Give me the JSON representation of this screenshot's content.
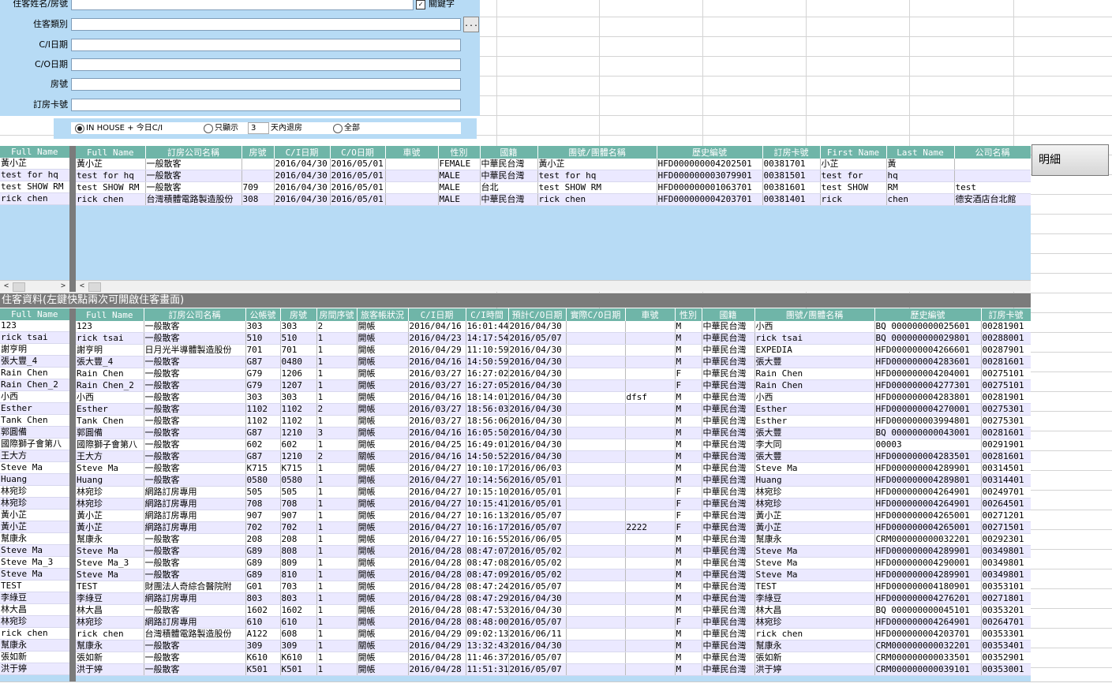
{
  "form": {
    "labels": [
      "住客姓名/房號",
      "住客類別",
      "C/I日期",
      "C/O日期",
      "房號",
      "訂房卡號"
    ],
    "keyword_label": "關鍵字",
    "keyword_checked": true,
    "dots_label": "..."
  },
  "filter": {
    "opt1": "IN HOUSE + 今日C/I",
    "opt2_prefix": "只顯示",
    "opt2_days": "3",
    "opt2_suffix": "天內退房",
    "opt3": "全部",
    "selected": "opt1"
  },
  "detail_button": "明細",
  "top_grid": {
    "fixed_header": "Full Name",
    "fixed_rows": [
      "黃小芷",
      "test for hq",
      "test SHOW RM",
      "rick chen"
    ],
    "columns": [
      "Full Name",
      "訂房公司名稱",
      "房號",
      "C/I日期",
      "C/O日期",
      "車號",
      "性別",
      "國籍",
      "團號/團體名稱",
      "歷史編號",
      "訂房卡號",
      "First Name",
      "Last Name",
      "公司名稱"
    ],
    "rows": [
      [
        "黃小芷",
        "一般散客",
        "",
        "2016/04/30",
        "2016/05/01",
        "",
        "FEMALE",
        "中華民台灣",
        "黃小芷",
        "HFD000000004202501",
        "00381701",
        "小芷",
        "黃",
        ""
      ],
      [
        "test for hq",
        "一般散客",
        "",
        "2016/04/30",
        "2016/05/01",
        "",
        "MALE",
        "中華民台灣",
        "test for hq",
        "HFD000000003079901",
        "00381501",
        "test for",
        "hq",
        ""
      ],
      [
        "test SHOW RM",
        "一般散客",
        "709",
        "2016/04/30",
        "2016/05/01",
        "",
        "MALE",
        "台北",
        "test SHOW RM",
        "HFD000000001063701",
        "00381601",
        "test SHOW",
        "RM",
        "test"
      ],
      [
        "rick chen",
        "台灣積體電路製造股份",
        "308",
        "2016/04/30",
        "2016/05/01",
        "",
        "MALE",
        "中華民台灣",
        "rick chen",
        "HFD000000004203701",
        "00381401",
        "rick",
        "chen",
        "德安酒店台北館"
      ]
    ]
  },
  "section_title": "住客資料(左鍵快點兩次可開啟住客畫面)",
  "bottom_grid": {
    "fixed_header": "Full Name",
    "columns": [
      "Full Name",
      "訂房公司名稱",
      "公帳號",
      "房號",
      "房間序號",
      "旅客帳狀況",
      "C/I日期",
      "C/I時間",
      "預計C/O日期",
      "實際C/O日期",
      "車號",
      "性別",
      "國籍",
      "團號/團體名稱",
      "歷史編號",
      "訂房卡號"
    ],
    "rows": [
      [
        "123",
        "123",
        "一般散客",
        "303",
        "303",
        "2",
        "開帳",
        "2016/04/16",
        "16:01:44",
        "2016/04/30",
        "",
        "",
        "M",
        "中華民台灣",
        "小西",
        "BQ 000000000025601",
        "00281901"
      ],
      [
        "rick tsai",
        "rick tsai",
        "一般散客",
        "510",
        "510",
        "1",
        "開帳",
        "2016/04/23",
        "14:17:54",
        "2016/05/07",
        "",
        "",
        "M",
        "中華民台灣",
        "rick tsai",
        "BQ 000000000029801",
        "00288001"
      ],
      [
        "謝亨明",
        "謝亨明",
        "日月光半導體製造股份",
        "701",
        "701",
        "1",
        "開帳",
        "2016/04/29",
        "11:10:59",
        "2016/04/30",
        "",
        "",
        "M",
        "中華民台灣",
        "EXPEDIA",
        "HFD000000004266601",
        "00287901"
      ],
      [
        "張大豐_4",
        "張大豐_4",
        "一般散客",
        "G87",
        "0480",
        "1",
        "開帳",
        "2016/04/16",
        "14:50:59",
        "2016/04/30",
        "",
        "",
        "M",
        "中華民台灣",
        "張大豐",
        "HFD000000004283601",
        "00281601"
      ],
      [
        "Rain Chen",
        "Rain Chen",
        "一般散客",
        "G79",
        "1206",
        "1",
        "開帳",
        "2016/03/27",
        "16:27:02",
        "2016/04/30",
        "",
        "",
        "F",
        "中華民台灣",
        "Rain Chen",
        "HFD000000004204001",
        "00275101"
      ],
      [
        "Rain Chen_2",
        "Rain Chen_2",
        "一般散客",
        "G79",
        "1207",
        "1",
        "開帳",
        "2016/03/27",
        "16:27:05",
        "2016/04/30",
        "",
        "",
        "F",
        "中華民台灣",
        "Rain Chen",
        "HFD000000004277301",
        "00275101"
      ],
      [
        "小西",
        "小西",
        "一般散客",
        "303",
        "303",
        "1",
        "開帳",
        "2016/04/16",
        "18:14:01",
        "2016/04/30",
        "",
        "dfsf",
        "M",
        "中華民台灣",
        "小西",
        "HFD000000004283801",
        "00281901"
      ],
      [
        "Esther",
        "Esther",
        "一般散客",
        "1102",
        "1102",
        "2",
        "開帳",
        "2016/03/27",
        "18:56:03",
        "2016/04/30",
        "",
        "",
        "M",
        "中華民台灣",
        "Esther",
        "HFD000000004270001",
        "00275301"
      ],
      [
        "Tank Chen",
        "Tank Chen",
        "一般散客",
        "1102",
        "1102",
        "1",
        "開帳",
        "2016/03/27",
        "18:56:06",
        "2016/04/30",
        "",
        "",
        "M",
        "中華民台灣",
        "Esther",
        "HFD000000003994801",
        "00275301"
      ],
      [
        "郭圓備",
        "郭圓備",
        "一般散客",
        "G87",
        "1210",
        "3",
        "開帳",
        "2016/04/16",
        "16:05:50",
        "2016/04/30",
        "",
        "",
        "M",
        "中華民台灣",
        "張大豐",
        "BQ 000000000043001",
        "00281601"
      ],
      [
        "國際獅子會第八",
        "國際獅子會第八",
        "一般散客",
        "602",
        "602",
        "1",
        "開帳",
        "2016/04/25",
        "16:49:01",
        "2016/04/30",
        "",
        "",
        "M",
        "中華民台灣",
        "李大同",
        "00003",
        "00291901"
      ],
      [
        "王大方",
        "王大方",
        "一般散客",
        "G87",
        "1210",
        "2",
        "關帳",
        "2016/04/16",
        "14:50:52",
        "2016/04/30",
        "",
        "",
        "M",
        "中華民台灣",
        "張大豐",
        "HFD000000004283501",
        "00281601"
      ],
      [
        "Steve Ma",
        "Steve Ma",
        "一般散客",
        "K715",
        "K715",
        "1",
        "開帳",
        "2016/04/27",
        "10:10:17",
        "2016/06/03",
        "",
        "",
        "M",
        "中華民台灣",
        "Steve Ma",
        "HFD000000004289901",
        "00314501"
      ],
      [
        "Huang",
        "Huang",
        "一般散客",
        "0580",
        "0580",
        "1",
        "開帳",
        "2016/04/27",
        "10:14:56",
        "2016/05/01",
        "",
        "",
        "M",
        "中華民台灣",
        "Huang",
        "HFD000000004289801",
        "00314401"
      ],
      [
        "林宛珍",
        "林宛珍",
        "網路訂房專用",
        "505",
        "505",
        "1",
        "開帳",
        "2016/04/27",
        "10:15:10",
        "2016/05/01",
        "",
        "",
        "F",
        "中華民台灣",
        "林宛珍",
        "HFD000000004264901",
        "00249701"
      ],
      [
        "林宛珍",
        "林宛珍",
        "網路訂房專用",
        "708",
        "708",
        "1",
        "開帳",
        "2016/04/27",
        "10:15:41",
        "2016/05/01",
        "",
        "",
        "F",
        "中華民台灣",
        "林宛珍",
        "HFD000000004264901",
        "00264501"
      ],
      [
        "黃小芷",
        "黃小芷",
        "網路訂房專用",
        "907",
        "907",
        "1",
        "開帳",
        "2016/04/27",
        "10:16:13",
        "2016/05/07",
        "",
        "",
        "F",
        "中華民台灣",
        "黃小芷",
        "HFD000000004265001",
        "00271201"
      ],
      [
        "黃小芷",
        "黃小芷",
        "網路訂房專用",
        "702",
        "702",
        "1",
        "開帳",
        "2016/04/27",
        "10:16:17",
        "2016/05/07",
        "",
        "2222",
        "F",
        "中華民台灣",
        "黃小芷",
        "HFD000000004265001",
        "00271501"
      ],
      [
        "幫康永",
        "幫康永",
        "一般散客",
        "208",
        "208",
        "1",
        "開帳",
        "2016/04/27",
        "10:16:55",
        "2016/06/05",
        "",
        "",
        "M",
        "中華民台灣",
        "幫康永",
        "CRM000000000032201",
        "00292301"
      ],
      [
        "Steve Ma",
        "Steve Ma",
        "一般散客",
        "G89",
        "808",
        "1",
        "開帳",
        "2016/04/28",
        "08:47:07",
        "2016/05/02",
        "",
        "",
        "M",
        "中華民台灣",
        "Steve Ma",
        "HFD000000004289901",
        "00349801"
      ],
      [
        "Steve Ma_3",
        "Steve Ma_3",
        "一般散客",
        "G89",
        "809",
        "1",
        "開帳",
        "2016/04/28",
        "08:47:08",
        "2016/05/02",
        "",
        "",
        "M",
        "中華民台灣",
        "Steve Ma",
        "HFD000000004290001",
        "00349801"
      ],
      [
        "Steve Ma",
        "Steve Ma",
        "一般散客",
        "G89",
        "810",
        "1",
        "開帳",
        "2016/04/28",
        "08:47:09",
        "2016/05/02",
        "",
        "",
        "M",
        "中華民台灣",
        "Steve Ma",
        "HFD000000004289901",
        "00349801"
      ],
      [
        "TEST",
        "TEST",
        "財團法人奇綜合醫院附",
        "G01",
        "703",
        "1",
        "開帳",
        "2016/04/28",
        "08:47:24",
        "2016/05/07",
        "",
        "",
        "M",
        "中華民台灣",
        "TEST",
        "HFD000000004180901",
        "00353101"
      ],
      [
        "李綠豆",
        "李綠豆",
        "網路訂房專用",
        "803",
        "803",
        "1",
        "開帳",
        "2016/04/28",
        "08:47:29",
        "2016/04/30",
        "",
        "",
        "M",
        "中華民台灣",
        "李綠豆",
        "HFD000000004276201",
        "00271801"
      ],
      [
        "林大昌",
        "林大昌",
        "一般散客",
        "1602",
        "1602",
        "1",
        "開帳",
        "2016/04/28",
        "08:47:53",
        "2016/04/30",
        "",
        "",
        "M",
        "中華民台灣",
        "林大昌",
        "BQ 000000000045101",
        "00353201"
      ],
      [
        "林宛珍",
        "林宛珍",
        "網路訂房專用",
        "610",
        "610",
        "1",
        "開帳",
        "2016/04/28",
        "08:48:00",
        "2016/05/07",
        "",
        "",
        "F",
        "中華民台灣",
        "林宛珍",
        "HFD000000004264901",
        "00264701"
      ],
      [
        "rick chen",
        "rick chen",
        "台灣積體電路製造股份",
        "A122",
        "608",
        "1",
        "開帳",
        "2016/04/29",
        "09:02:13",
        "2016/06/11",
        "",
        "",
        "M",
        "中華民台灣",
        "rick chen",
        "HFD000000004203701",
        "00353301"
      ],
      [
        "幫康永",
        "幫康永",
        "一般散客",
        "309",
        "309",
        "1",
        "關帳",
        "2016/04/29",
        "13:32:43",
        "2016/04/30",
        "",
        "",
        "M",
        "中華民台灣",
        "幫康永",
        "CRM000000000032201",
        "00353401"
      ],
      [
        "張如新",
        "張如新",
        "一般散客",
        "K610",
        "K610",
        "1",
        "開帳",
        "2016/04/28",
        "11:46:37",
        "2016/05/07",
        "",
        "",
        "M",
        "中華民台灣",
        "張如新",
        "CRM000000000033501",
        "00352901"
      ],
      [
        "洪于婷",
        "洪于婷",
        "一般散客",
        "K501",
        "K501",
        "1",
        "開帳",
        "2016/04/28",
        "11:51:31",
        "2016/05/07",
        "",
        "",
        "M",
        "中華民台灣",
        "洪于婷",
        "CRM000000000039101",
        "00353001"
      ]
    ]
  }
}
